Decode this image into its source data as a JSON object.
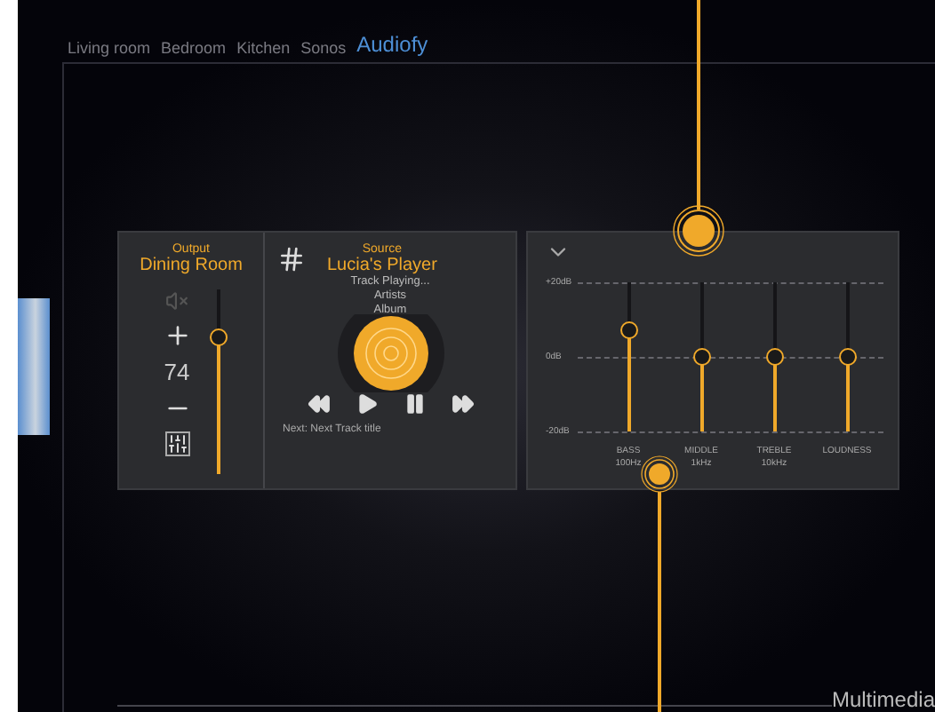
{
  "tabs": [
    {
      "label": "Living room",
      "selected": false
    },
    {
      "label": "Bedroom",
      "selected": false
    },
    {
      "label": "Kitchen",
      "selected": false
    },
    {
      "label": "Sonos",
      "selected": false
    },
    {
      "label": "Audiofy",
      "selected": true
    }
  ],
  "output": {
    "label": "Output",
    "name": "Dining Room",
    "volume": "74",
    "level": 0.74
  },
  "source": {
    "label": "Source",
    "name": "Lucia's Player",
    "track": "Track Playing...",
    "artist": "Artists",
    "album": "Album",
    "next": "Next: Next Track title"
  },
  "equalizer": {
    "scale": [
      "+20dB",
      "0dB",
      "-20dB"
    ],
    "bands": [
      {
        "label": "BASS",
        "sub": "100Hz",
        "level": 0.68
      },
      {
        "label": "MIDDLE",
        "sub": "1kHz",
        "level": 0.5
      },
      {
        "label": "TREBLE",
        "sub": "10kHz",
        "level": 0.5
      },
      {
        "label": "LOUDNESS",
        "level": 0.5
      }
    ]
  },
  "footer": "Multimedia"
}
